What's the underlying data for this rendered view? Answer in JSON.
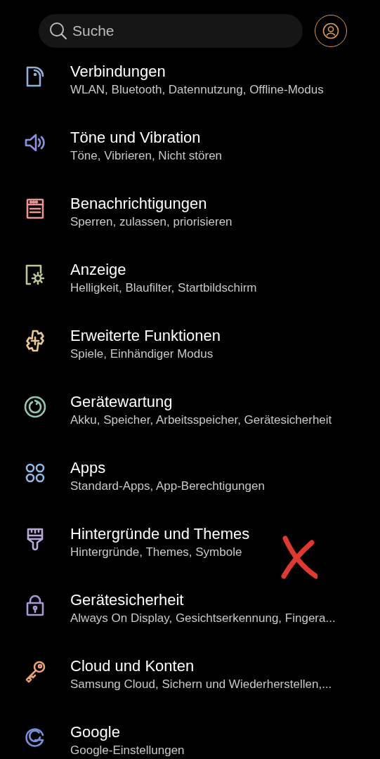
{
  "search": {
    "placeholder": "Suche"
  },
  "items": [
    {
      "title": "Verbindungen",
      "subtitle": "WLAN, Bluetooth, Datennutzung, Offline-Modus",
      "color": "#8fb0d8"
    },
    {
      "title": "Töne und Vibration",
      "subtitle": "Töne, Vibrieren, Nicht stören",
      "color": "#8a90e0"
    },
    {
      "title": "Benachrichtigungen",
      "subtitle": "Sperren, zulassen, priorisieren",
      "color": "#e89494"
    },
    {
      "title": "Anzeige",
      "subtitle": "Helligkeit, Blaufilter, Startbildschirm",
      "color": "#b8c890"
    },
    {
      "title": "Erweiterte Funktionen",
      "subtitle": "Spiele, Einhändiger Modus",
      "color": "#e8c890"
    },
    {
      "title": "Gerätewartung",
      "subtitle": "Akku, Speicher, Arbeitsspeicher, Gerätesicherheit",
      "color": "#90c8b0"
    },
    {
      "title": "Apps",
      "subtitle": "Standard-Apps, App-Berechtigungen",
      "color": "#90b8e8"
    },
    {
      "title": "Hintergründe und Themes",
      "subtitle": "Hintergründe, Themes, Symbole",
      "color": "#b8a8d8"
    },
    {
      "title": "Gerätesicherheit",
      "subtitle": "Always On Display, Gesichtserkennung, Fingera...",
      "color": "#a898d8"
    },
    {
      "title": "Cloud und Konten",
      "subtitle": "Samsung Cloud, Sichern und Wiederherstellen,...",
      "color": "#e8a078"
    },
    {
      "title": "Google",
      "subtitle": "Google-Einstellungen",
      "color": "#7890d8"
    }
  ]
}
